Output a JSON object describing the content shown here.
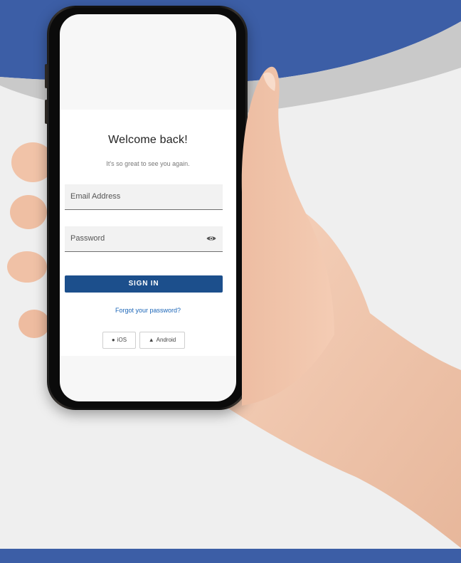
{
  "login": {
    "title": "Welcome back!",
    "subtitle": "It's so great to see you again.",
    "email": {
      "placeholder": "Email Address",
      "value": ""
    },
    "password": {
      "placeholder": "Password",
      "value": ""
    },
    "signin_label": "SIGN IN",
    "forgot_label": "Forgot your password?",
    "store_buttons": [
      {
        "label": "iOS",
        "icon": "apple-icon"
      },
      {
        "label": "Android",
        "icon": "android-icon"
      }
    ]
  },
  "colors": {
    "brand_blue": "#3c5ea6",
    "button_blue": "#1c4f8c",
    "link_blue": "#1c66b8",
    "field_bg": "#f2f2f2"
  }
}
